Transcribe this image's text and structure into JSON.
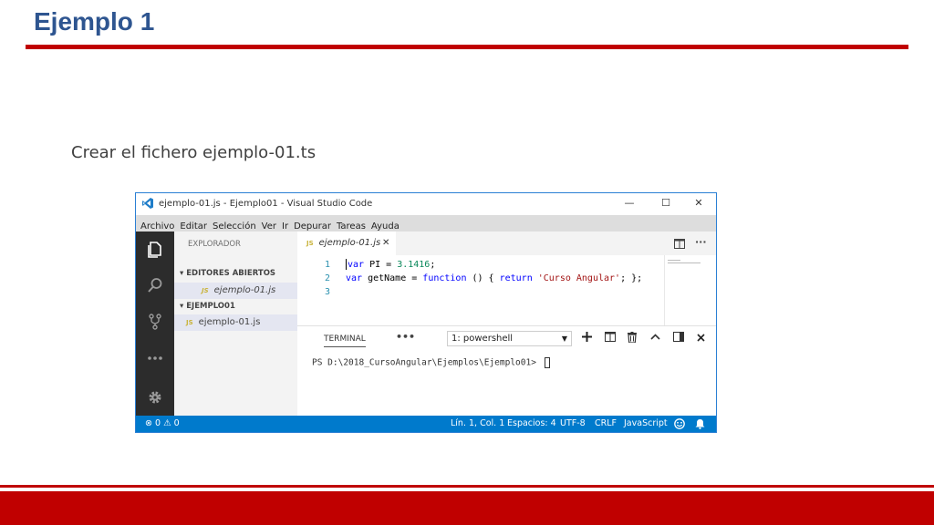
{
  "slide": {
    "title": "Ejemplo 1",
    "subtitle": "Crear el fichero ejemplo-01.ts"
  },
  "window": {
    "title": "ejemplo-01.js - Ejemplo01 - Visual Studio Code",
    "controls": {
      "minimize": "—",
      "maximize": "☐",
      "close": "✕"
    }
  },
  "menu": [
    "Archivo",
    "Editar",
    "Selección",
    "Ver",
    "Ir",
    "Depurar",
    "Tareas",
    "Ayuda"
  ],
  "activity_icons": [
    "explorer-icon",
    "search-icon",
    "source-control-icon",
    "more-icon",
    "gear-icon"
  ],
  "sidebar": {
    "header": "EXPLORADOR",
    "open_editors_label": "EDITORES ABIERTOS",
    "open_editors": [
      {
        "tag": "JS",
        "name": "ejemplo-01.js"
      }
    ],
    "folder_label": "EJEMPLO01",
    "files": [
      {
        "tag": "JS",
        "name": "ejemplo-01.js"
      }
    ]
  },
  "editor": {
    "tab": {
      "tag": "JS",
      "name": "ejemplo-01.js",
      "close": "✕"
    },
    "lines": [
      {
        "n": "1",
        "t": [
          [
            "kw",
            "var"
          ],
          [
            "",
            " PI = "
          ],
          [
            "num",
            "3.1416"
          ],
          [
            "",
            ";"
          ]
        ]
      },
      {
        "n": "2",
        "t": [
          [
            "kw",
            "var"
          ],
          [
            "",
            " getName = "
          ],
          [
            "kw",
            "function"
          ],
          [
            "",
            " () { "
          ],
          [
            "kw",
            "return"
          ],
          [
            "",
            " "
          ],
          [
            "str",
            "'Curso Angular'"
          ],
          [
            "",
            "; };"
          ]
        ]
      },
      {
        "n": "3",
        "t": []
      }
    ]
  },
  "panel": {
    "title": "TERMINAL",
    "dots": "•••",
    "selected_terminal": "1: powershell",
    "prompt": "PS D:\\2018_CursoAngular\\Ejemplos\\Ejemplo01> "
  },
  "status": {
    "errors": "0",
    "warnings": "0",
    "position": "Lín. 1, Col. 1",
    "spaces": "Espacios: 4",
    "encoding": "UTF-8",
    "eol": "CRLF",
    "language": "JavaScript"
  },
  "colors": {
    "slide_title": "#2e5590",
    "slide_accent": "#c00000",
    "status_bar": "#007acc",
    "activity_bar": "#2c2c2c"
  }
}
